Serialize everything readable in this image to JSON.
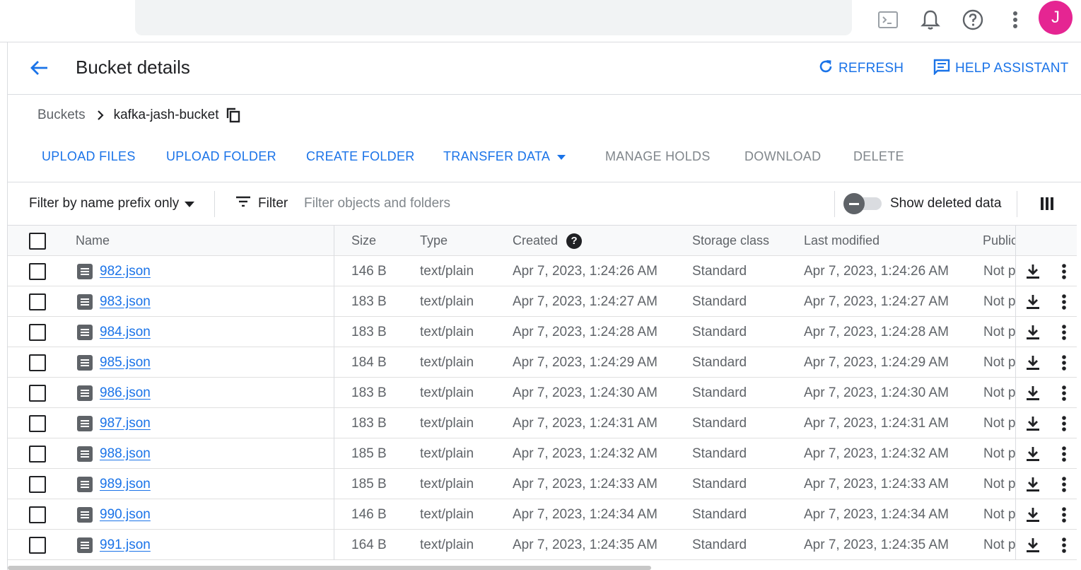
{
  "topbar": {
    "icons": [
      "terminal-icon",
      "bell-icon",
      "help-icon",
      "more-vert-icon"
    ],
    "avatar_initial": "J"
  },
  "header": {
    "title": "Bucket details",
    "refresh_label": "REFRESH",
    "help_assistant_label": "HELP ASSISTANT"
  },
  "breadcrumb": {
    "parent": "Buckets",
    "current": "kafka-jash-bucket"
  },
  "actions": {
    "upload_files": "UPLOAD FILES",
    "upload_folder": "UPLOAD FOLDER",
    "create_folder": "CREATE FOLDER",
    "transfer_data": "TRANSFER DATA",
    "manage_holds": "MANAGE HOLDS",
    "download": "DOWNLOAD",
    "delete": "DELETE"
  },
  "filters": {
    "prefix_select": "Filter by name prefix only",
    "filter_label": "Filter",
    "filter_placeholder": "Filter objects and folders",
    "show_deleted_label": "Show deleted data"
  },
  "table": {
    "columns": [
      "Name",
      "Size",
      "Type",
      "Created",
      "Storage class",
      "Last modified",
      "Public"
    ],
    "rows": [
      {
        "name": "982.json",
        "size": "146 B",
        "type": "text/plain",
        "created": "Apr 7, 2023, 1:24:26 AM",
        "storage": "Standard",
        "modified": "Apr 7, 2023, 1:24:26 AM",
        "public": "Not p"
      },
      {
        "name": "983.json",
        "size": "183 B",
        "type": "text/plain",
        "created": "Apr 7, 2023, 1:24:27 AM",
        "storage": "Standard",
        "modified": "Apr 7, 2023, 1:24:27 AM",
        "public": "Not p"
      },
      {
        "name": "984.json",
        "size": "183 B",
        "type": "text/plain",
        "created": "Apr 7, 2023, 1:24:28 AM",
        "storage": "Standard",
        "modified": "Apr 7, 2023, 1:24:28 AM",
        "public": "Not p"
      },
      {
        "name": "985.json",
        "size": "184 B",
        "type": "text/plain",
        "created": "Apr 7, 2023, 1:24:29 AM",
        "storage": "Standard",
        "modified": "Apr 7, 2023, 1:24:29 AM",
        "public": "Not p"
      },
      {
        "name": "986.json",
        "size": "183 B",
        "type": "text/plain",
        "created": "Apr 7, 2023, 1:24:30 AM",
        "storage": "Standard",
        "modified": "Apr 7, 2023, 1:24:30 AM",
        "public": "Not p"
      },
      {
        "name": "987.json",
        "size": "183 B",
        "type": "text/plain",
        "created": "Apr 7, 2023, 1:24:31 AM",
        "storage": "Standard",
        "modified": "Apr 7, 2023, 1:24:31 AM",
        "public": "Not p"
      },
      {
        "name": "988.json",
        "size": "185 B",
        "type": "text/plain",
        "created": "Apr 7, 2023, 1:24:32 AM",
        "storage": "Standard",
        "modified": "Apr 7, 2023, 1:24:32 AM",
        "public": "Not p"
      },
      {
        "name": "989.json",
        "size": "185 B",
        "type": "text/plain",
        "created": "Apr 7, 2023, 1:24:33 AM",
        "storage": "Standard",
        "modified": "Apr 7, 2023, 1:24:33 AM",
        "public": "Not p"
      },
      {
        "name": "990.json",
        "size": "146 B",
        "type": "text/plain",
        "created": "Apr 7, 2023, 1:24:34 AM",
        "storage": "Standard",
        "modified": "Apr 7, 2023, 1:24:34 AM",
        "public": "Not p"
      },
      {
        "name": "991.json",
        "size": "164 B",
        "type": "text/plain",
        "created": "Apr 7, 2023, 1:24:35 AM",
        "storage": "Standard",
        "modified": "Apr 7, 2023, 1:24:35 AM",
        "public": "Not p"
      }
    ]
  },
  "colors": {
    "accent": "#1a73e8",
    "avatar": "#e52592",
    "muted": "#5f6368"
  }
}
